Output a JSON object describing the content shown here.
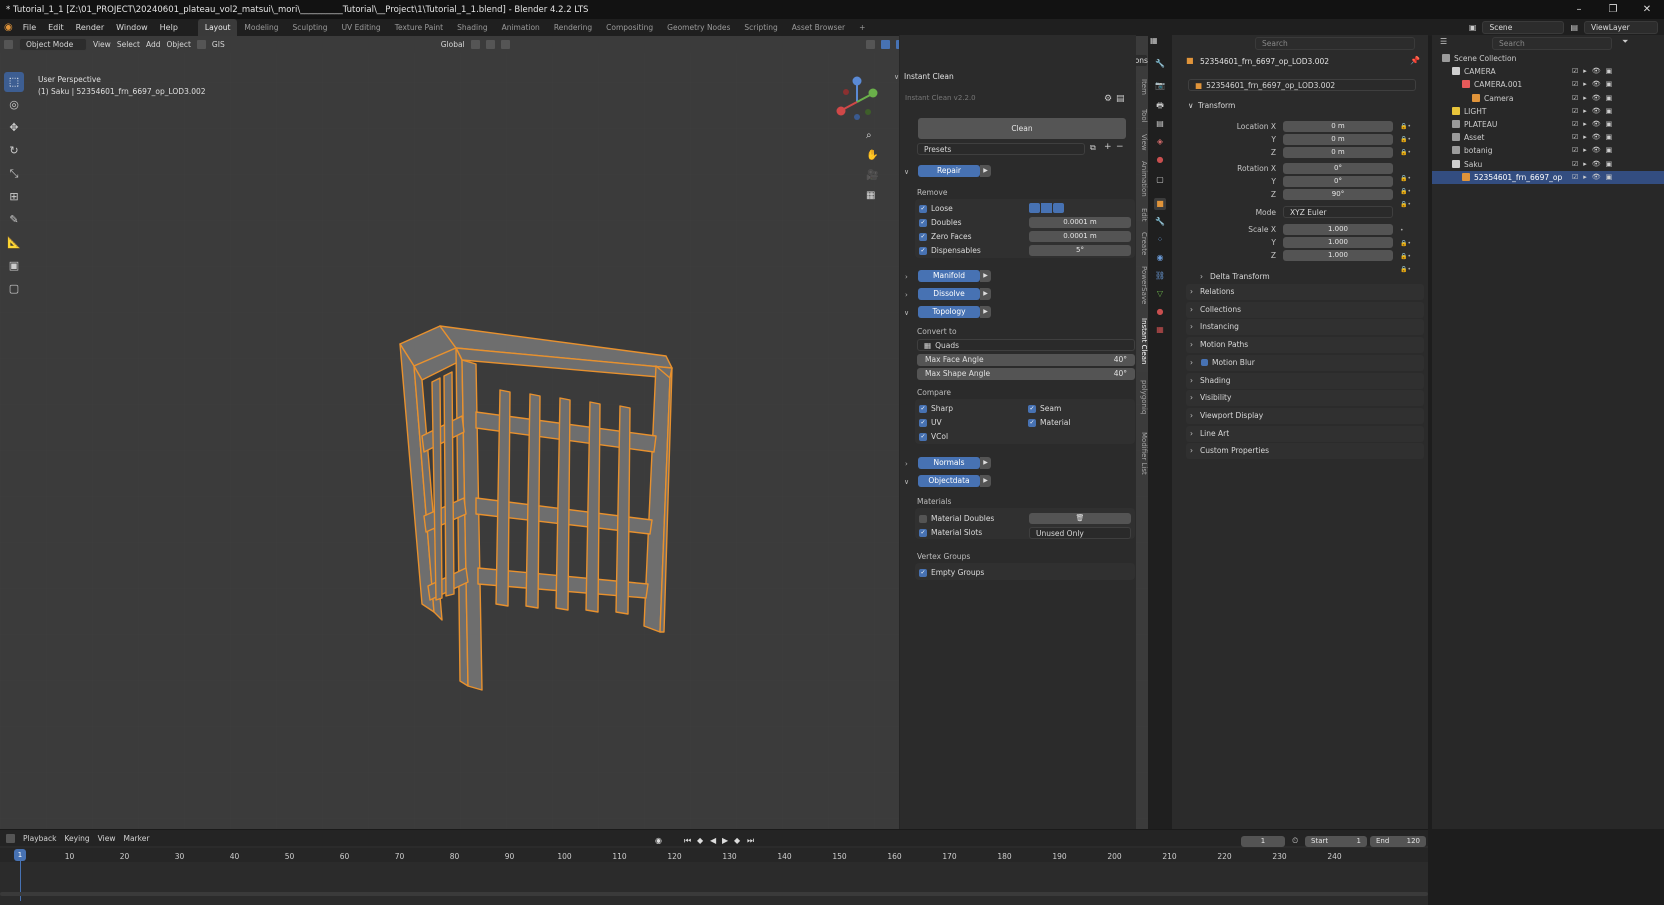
{
  "window": {
    "title": "* Tutorial_1_1 [Z:\\01_PROJECT\\20240601_plateau_vol2_matsui\\_mori\\__________Tutorial\\__Project\\1\\Tutorial_1_1.blend] - Blender 4.2.2 LTS",
    "min": "–",
    "max": "❐",
    "close": "✕"
  },
  "menu": [
    "File",
    "Edit",
    "Render",
    "Window",
    "Help"
  ],
  "workspaces": [
    "Layout",
    "Modeling",
    "Sculpting",
    "UV Editing",
    "Texture Paint",
    "Shading",
    "Animation",
    "Rendering",
    "Compositing",
    "Geometry Nodes",
    "Scripting",
    "Asset Browser",
    "+"
  ],
  "top_right": {
    "scene": "Scene",
    "viewlayer": "ViewLayer"
  },
  "viewport": {
    "mode": "Object Mode",
    "menus": [
      "View",
      "Select",
      "Add",
      "Object"
    ],
    "gis": "GIS",
    "orientation": "Global",
    "options": "Options",
    "info_line1": "User Perspective",
    "info_line2": "(1) Saku | 52354601_frn_6697_op_LOD3.002"
  },
  "npanel": {
    "header": "Instant Clean",
    "version": "Instant Clean v2.2.0",
    "clean_button": "Clean",
    "presets": "Presets",
    "repair": "Repair",
    "remove_label": "Remove",
    "remove": [
      {
        "label": "Loose",
        "value": ""
      },
      {
        "label": "Doubles",
        "value": "0.0001 m"
      },
      {
        "label": "Zero Faces",
        "value": "0.0001 m"
      },
      {
        "label": "Dispensables",
        "value": "5°"
      }
    ],
    "manifold": "Manifold",
    "dissolve": "Dissolve",
    "topology": "Topology",
    "convert_to_label": "Convert to",
    "convert_to": "Quads",
    "max_face_angle": {
      "label": "Max Face Angle",
      "value": "40°"
    },
    "max_shape_angle": {
      "label": "Max Shape Angle",
      "value": "40°"
    },
    "compare_label": "Compare",
    "compare": [
      "Sharp",
      "Seam",
      "UV",
      "Material",
      "VCol"
    ],
    "normals": "Normals",
    "objectdata": "Objectdata",
    "materials_label": "Materials",
    "material_doubles": "Material Doubles",
    "material_slots": "Material Slots",
    "material_slots_value": "Unused Only",
    "vertex_groups_label": "Vertex Groups",
    "empty_groups": "Empty Groups",
    "tabs": [
      "Item",
      "Tool",
      "View",
      "Animation",
      "Edit",
      "Create",
      "PowerSave",
      "Instant Clean",
      "polygoniq",
      "Modifier List"
    ]
  },
  "properties": {
    "search_placeholder": "Search",
    "object_name": "52354601_frn_6697_op_LOD3.002",
    "data_name": "52354601_frn_6697_op_LOD3.002",
    "transform": "Transform",
    "location": {
      "label": "Location X",
      "x": "0 m",
      "y": "0 m",
      "z": "0 m"
    },
    "rotation": {
      "label": "Rotation X",
      "x": "0°",
      "y": "0°",
      "z": "90°"
    },
    "mode_label": "Mode",
    "mode_value": "XYZ Euler",
    "scale": {
      "label": "Scale X",
      "x": "1.000",
      "y": "1.000",
      "z": "1.000"
    },
    "axis_y": "Y",
    "axis_z": "Z",
    "delta_transform": "Delta Transform",
    "sections": [
      "Relations",
      "Collections",
      "Instancing",
      "Motion Paths",
      "Motion Blur",
      "Shading",
      "Visibility",
      "Viewport Display",
      "Line Art",
      "Custom Properties"
    ]
  },
  "outliner": {
    "search_placeholder": "Search",
    "rows": [
      {
        "name": "Scene Collection",
        "indent": 0,
        "color": "#9b9b9b"
      },
      {
        "name": "CAMERA",
        "indent": 1,
        "color": "#cfcfcf"
      },
      {
        "name": "CAMERA.001",
        "indent": 2,
        "color": "#e85a5a"
      },
      {
        "name": "Camera",
        "indent": 3,
        "color": "#e0943a"
      },
      {
        "name": "LIGHT",
        "indent": 1,
        "color": "#e8c43a"
      },
      {
        "name": "PLATEAU",
        "indent": 1,
        "color": "#9b9b9b"
      },
      {
        "name": "Asset",
        "indent": 1,
        "color": "#9b9b9b"
      },
      {
        "name": "botanig",
        "indent": 1,
        "color": "#9b9b9b"
      },
      {
        "name": "Saku",
        "indent": 1,
        "color": "#cfcfcf"
      },
      {
        "name": "52354601_frn_6697_op",
        "indent": 2,
        "color": "#e0943a"
      }
    ]
  },
  "timeline": {
    "menus": [
      "Playback",
      "Keying",
      "View",
      "Marker"
    ],
    "current": "1",
    "start_label": "Start",
    "start": "1",
    "end_label": "End",
    "end": "120",
    "ticks": [
      "1",
      "10",
      "20",
      "30",
      "40",
      "50",
      "60",
      "70",
      "80",
      "90",
      "100",
      "110",
      "120",
      "130",
      "140",
      "150",
      "160",
      "170",
      "180",
      "190",
      "200",
      "210",
      "220",
      "230",
      "240"
    ]
  },
  "colors": {
    "accent": "#4772b3",
    "selection": "#e8912e",
    "viewport": "#3b3b3b"
  }
}
